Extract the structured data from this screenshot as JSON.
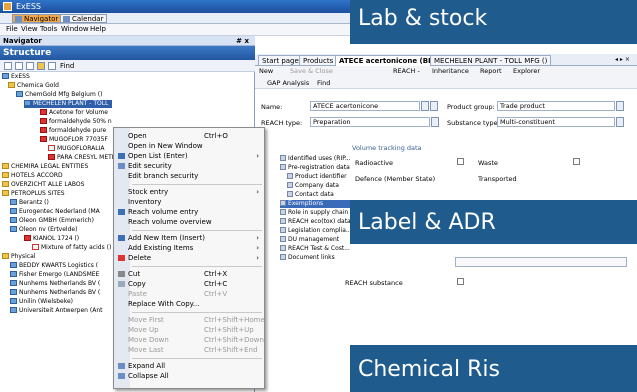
{
  "app": {
    "title": "ExESS"
  },
  "apptabs": [
    {
      "label": "Navigator"
    },
    {
      "label": "Calendar"
    }
  ],
  "menu": [
    "File",
    "View",
    "Tools",
    "Window",
    "Help"
  ],
  "navigator": {
    "header": "Navigator",
    "pin": "# x",
    "title": "Structure",
    "find": "Find"
  },
  "tree": [
    {
      "label": "ExESS"
    },
    {
      "label": "Chemica Gold"
    },
    {
      "label": "ChemGold Mfg Belgium ()"
    },
    {
      "label": "MECHELEN PLANT - TOLL"
    },
    {
      "label": "Acetone for Volume"
    },
    {
      "label": "formaldehyde 50% n"
    },
    {
      "label": "formaldehyde pure"
    },
    {
      "label": "MUGOFLOR 77035F"
    },
    {
      "label": "MUGOFLORALIA"
    },
    {
      "label": "PARA CRESYL METH"
    },
    {
      "label": "CHEMIRA LEGAL ENTITIES"
    },
    {
      "label": "HOTELS ACCORD"
    },
    {
      "label": "OVERZICHT ALLE LABOS"
    },
    {
      "label": "PETROPLUS SITES"
    },
    {
      "label": "Berantz ()"
    },
    {
      "label": "Eurogentec Nederland (MA"
    },
    {
      "label": "Oleon GMBH (Emmerich)"
    },
    {
      "label": "Oleon nv (Ertvelde)"
    },
    {
      "label": "KIANOL 1724 ()"
    },
    {
      "label": "Mixture of fatty acids ()"
    },
    {
      "label": "Physical"
    },
    {
      "label": "BEDDY KWARTS Logistics ("
    },
    {
      "label": "Fisher Emergo (LANDSMEE"
    },
    {
      "label": "Nunhems Netherlands BV ("
    },
    {
      "label": "Nunhems Netherlands BV ("
    },
    {
      "label": "Unilin (Wielsbeke)"
    },
    {
      "label": "Universiteit Antwerpen (Ant"
    }
  ],
  "context_menu": {
    "items": [
      {
        "label": "Open",
        "shortcut": "Ctrl+O"
      },
      {
        "label": "Open in New Window"
      },
      {
        "label": "Open List (Enter)",
        "arrow": "›"
      },
      {
        "label": "Edit security"
      },
      {
        "label": "Edit branch security"
      },
      {
        "label": "Stock entry",
        "arrow": "›"
      },
      {
        "label": "Inventory"
      },
      {
        "label": "Reach volume entry"
      },
      {
        "label": "Reach volume overview"
      },
      {
        "label": "Add New Item (Insert)",
        "arrow": "›"
      },
      {
        "label": "Add Existing Items",
        "arrow": "›"
      },
      {
        "label": "Delete",
        "arrow": "›"
      },
      {
        "label": "Cut",
        "shortcut": "Ctrl+X"
      },
      {
        "label": "Copy",
        "shortcut": "Ctrl+C"
      },
      {
        "label": "Paste",
        "shortcut": "Ctrl+V"
      },
      {
        "label": "Replace With Copy..."
      },
      {
        "label": "Move First",
        "shortcut": "Ctrl+Shift+Home"
      },
      {
        "label": "Move Up",
        "shortcut": "Ctrl+Shift+Up"
      },
      {
        "label": "Move Down",
        "shortcut": "Ctrl+Shift+Down"
      },
      {
        "label": "Move Last",
        "shortcut": "Ctrl+Shift+End"
      },
      {
        "label": "Expand All"
      },
      {
        "label": "Collapse All"
      }
    ]
  },
  "doc": {
    "tabs": [
      "Start page",
      "Products",
      "ATECE acertonicone (BIG)",
      "MECHELEN PLANT - TOLL MFG ()"
    ],
    "tab_controls": "◂ ▸ ×",
    "toolbar": [
      "New",
      "Save & Close",
      "REACH -",
      "Inheritance",
      "Report",
      "Explorer"
    ],
    "toolbar2": [
      "GAP Analysis",
      "Find"
    ],
    "fields": {
      "name_label": "Name:",
      "name_value": "ATECE acertonicone",
      "reach_type_label": "REACH type:",
      "reach_type_value": "Preparation",
      "product_group_label": "Product group:",
      "product_group_value": "Trade product",
      "substance_type_label": "Substance type:",
      "substance_type_value": "Multi-constituent"
    },
    "list": [
      "Identified uses (RIP...",
      "Pre-registration data",
      "Product identifier",
      "Company data",
      "Contact data",
      "Exemptions",
      "Role in supply chain",
      "REACH eco(tox) data",
      "Legislation complia...",
      "DU management",
      "REACH Test & Cost...",
      "Document links"
    ],
    "volume_header": "Volume tracking data",
    "checks": [
      "Radioactive",
      "Waste",
      "Defence (Member State)",
      "Transported"
    ],
    "reach_substance": "REACH substance"
  },
  "overlays": [
    "Lab & stock",
    "Label & ADR",
    "Chemical Ris"
  ]
}
